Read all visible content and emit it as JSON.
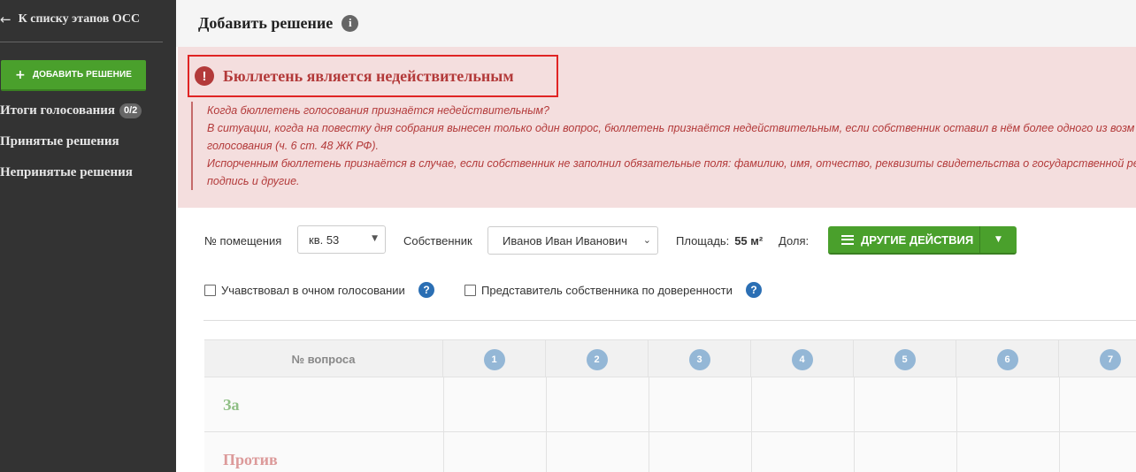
{
  "sidebar": {
    "back_label": "К списку этапов ОСС",
    "add_button_label": "ДОБАВИТЬ РЕШЕНИЕ",
    "items": [
      {
        "label": "Итоги голосования",
        "badge": "0/2"
      },
      {
        "label": "Принятые решения"
      },
      {
        "label": "Непринятые решения"
      }
    ]
  },
  "header": {
    "title": "Добавить решение"
  },
  "alert": {
    "title": "Бюллетень является недействительным",
    "lines": [
      "Когда бюллетень голосования признаётся недействительным?",
      "В ситуации, когда на повестку дня собрания вынесен только один вопрос, бюллетень признаётся недействительным, если собственник оставил в нём более одного из возм",
      "голосования (ч. 6 ст. 48 ЖК РФ).",
      "Испорченным бюллетень признаётся в случае, если собственник не заполнил обязательные поля: фамилию, имя, отчество, реквизиты свидетельства о государственной ре",
      "подпись и другие."
    ]
  },
  "form": {
    "room_label": "№ помещения",
    "room_value": "кв. 53",
    "owner_label": "Собственник",
    "owner_value": "Иванов Иван Иванович",
    "area_label": "Площадь:",
    "area_value": "55 м²",
    "share_label": "Доля:",
    "actions_label": "ДРУГИЕ ДЕЙСТВИЯ",
    "checkbox_in_person": "Учавствовал в очном голосовании",
    "checkbox_proxy": "Представитель собственника по доверенности"
  },
  "table": {
    "question_header": "№ вопроса",
    "questions": [
      "1",
      "2",
      "3",
      "4",
      "5",
      "6",
      "7"
    ],
    "rows": [
      {
        "label": "За",
        "color": "#8fbf85"
      },
      {
        "label": "Против",
        "color": "#dc9a9a"
      }
    ]
  },
  "colors": {
    "sidebar_bg": "#333333",
    "accent_green": "#4aa02c",
    "alert_bg": "#f4dede",
    "alert_text": "#b33a3a",
    "alert_border": "#e02424",
    "help_blue": "#2b6fb4"
  }
}
